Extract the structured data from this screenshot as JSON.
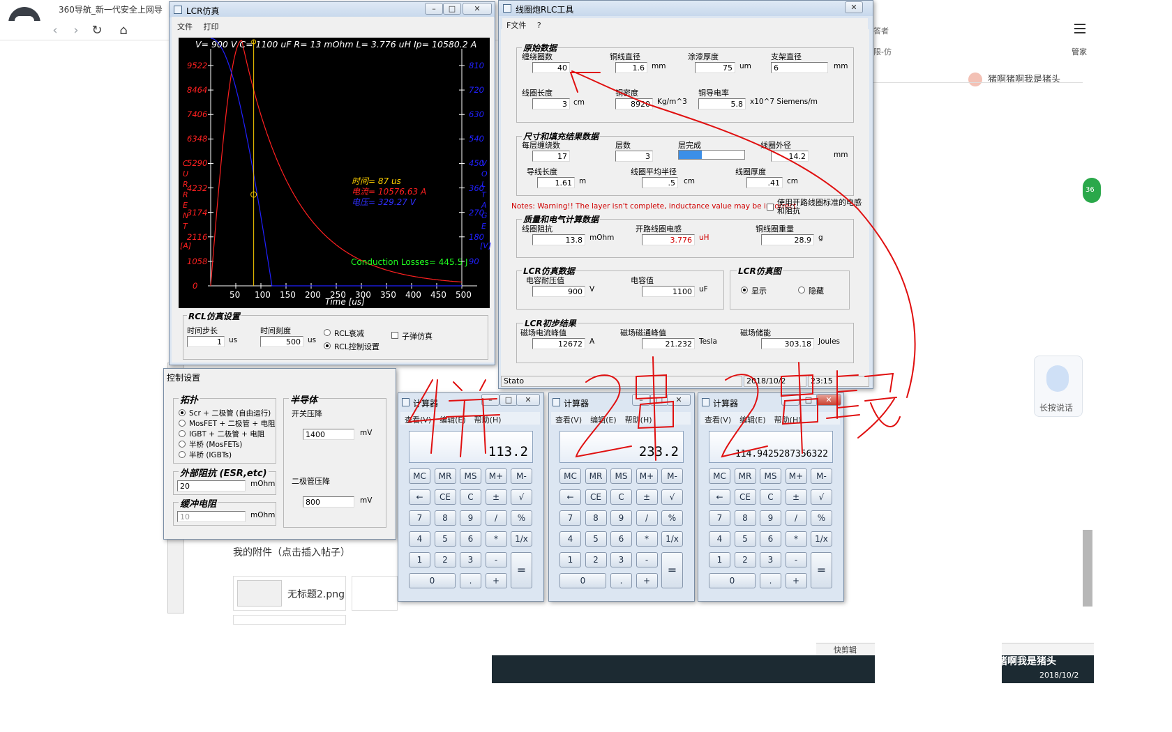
{
  "browser": {
    "tab_title": "360导航_新一代安全上网导",
    "user_name": "猪啊猪啊我是猪头",
    "manage_label": "管家",
    "voice_label": "长按说话",
    "badge_text": "36",
    "quick_edit": "快剪辑",
    "clock_text": "猪啊我是猪头",
    "clock_date": "2018/10/2",
    "right_snips": [
      "答者",
      "限-仿"
    ]
  },
  "attachments": {
    "title": "我的附件（点击插入帖子）",
    "items": [
      {
        "name": "无标题2.png"
      }
    ]
  },
  "lcr_window": {
    "title": "LCR仿真",
    "menu": [
      "文件",
      "打印"
    ],
    "plot": {
      "header": "V= 900 V    C= 1100 uF    R= 13 mOhm    L= 3.776 uH    Ip= 10580.2 A",
      "y_left_ticks": [
        "9522",
        "8464",
        "7406",
        "6348",
        "5290",
        "4232",
        "3174",
        "2116",
        "1058",
        "0"
      ],
      "y_right_ticks": [
        "810",
        "720",
        "630",
        "540",
        "450",
        "360",
        "270",
        "180",
        "90"
      ],
      "x_ticks": [
        "50",
        "100",
        "150",
        "200",
        "250",
        "300",
        "350",
        "400",
        "450",
        "500"
      ],
      "x_axis_title": "Time [us]",
      "y_left_title_letters": [
        "C",
        "U",
        "R",
        "R",
        "E",
        "N",
        "T"
      ],
      "y_left_unit": "[A]",
      "y_right_title_letters": [
        "V",
        "O",
        "L",
        "T",
        "A",
        "G",
        "E"
      ],
      "y_right_unit": "[V]",
      "annotation_time": "时间= 87 us",
      "annotation_current": "电流= 10576.63 A",
      "annotation_voltage": "电压= 329.27 V",
      "conduction_losses": "Conduction Losses= 445.5 J",
      "current_color": "#ff2020",
      "voltage_color": "#2020ff",
      "cursor_color": "#ffd000"
    },
    "settings": {
      "group_title": "RCL仿真设置",
      "time_step_label": "时间步长",
      "time_step_value": "1",
      "time_step_unit": "us",
      "time_scale_label": "时间刻度",
      "time_scale_value": "500",
      "time_scale_unit": "us",
      "radio_decay": "RCL衰减",
      "radio_control": "RCL控制设置",
      "checkbox_bullet": "子弹仿真"
    }
  },
  "rlc_window": {
    "title": "线圈炮RLC工具",
    "menu": [
      "F文件",
      "?"
    ],
    "raw_data": {
      "title": "原始数据",
      "turns_label": "缠绕圈数",
      "turns_value": "40",
      "wire_dia_label": "铜线直径",
      "wire_dia_value": "1.6",
      "wire_dia_unit": "mm",
      "paint_label": "涂漆厚度",
      "paint_value": "75",
      "paint_unit": "um",
      "frame_label": "支架直径",
      "frame_value": "6",
      "frame_unit": "mm",
      "length_label": "线圈长度",
      "length_value": "3",
      "length_unit": "cm",
      "density_label": "铜密度",
      "density_value": "8920",
      "density_unit": "Kg/m^3",
      "conductivity_label": "铜导电率",
      "conductivity_value": "5.8",
      "conductivity_unit": "x10^7 Siemens/m"
    },
    "size_data": {
      "title": "尺寸和填充结果数据",
      "per_layer_label": "每层缠绕数",
      "per_layer_value": "17",
      "layers_label": "层数",
      "layers_value": "3",
      "layer_done_label": "层完成",
      "outer_dia_label": "线圈外径",
      "outer_dia_value": "14.2",
      "outer_dia_unit": "mm",
      "wire_len_label": "导线长度",
      "wire_len_value": "1.61",
      "wire_len_unit": "m",
      "avg_radius_label": "线圈平均半径",
      "avg_radius_value": ".5",
      "avg_radius_unit": "cm",
      "thickness_label": "线圈厚度",
      "thickness_value": ".41",
      "thickness_unit": "cm",
      "layer_progress": 0.35
    },
    "warning": "Notes: Warning!! The layer isn't complete, inductance value may be incorrect",
    "open_circuit_checkbox": "使用开路线圈标准的电感和阻抗",
    "electrical": {
      "title": "质量和电气计算数据",
      "resistance_label": "线圈阻抗",
      "resistance_value": "13.8",
      "resistance_unit": "mOhm",
      "inductance_label": "开路线圈电感",
      "inductance_value": "3.776",
      "inductance_unit": "uH",
      "weight_label": "铜线圈重量",
      "weight_value": "28.9",
      "weight_unit": "g"
    },
    "lcr_sim": {
      "title": "LCR仿真数据",
      "cap_voltage_label": "电容耐压值",
      "cap_voltage_value": "900",
      "cap_voltage_unit": "V",
      "capacitance_label": "电容值",
      "capacitance_value": "1100",
      "capacitance_unit": "uF"
    },
    "lcr_plot": {
      "title": "LCR仿真图",
      "show": "显示",
      "hide": "隐藏"
    },
    "lcr_results": {
      "title": "LCR初步结果",
      "peak_current_label": "磁场电流峰值",
      "peak_current_value": "12672",
      "peak_current_unit": "A",
      "peak_flux_label": "磁场磁通峰值",
      "peak_flux_value": "21.232",
      "peak_flux_unit": "Tesla",
      "energy_label": "磁场储能",
      "energy_value": "303.18",
      "energy_unit": "Joules"
    },
    "status": [
      "Stato",
      "2018/10/2",
      "23:15"
    ]
  },
  "control_window": {
    "title": "控制设置",
    "topology_title": "拓扑",
    "topology_options": [
      "Scr + 二极管 (自由运行)",
      "MosFET + 二极管 + 电阻",
      "IGBT + 二极管 + 电阻",
      "半桥 (MosFETs)",
      "半桥 (IGBTs)"
    ],
    "semi_title": "半导体",
    "switch_drop_label": "开关压降",
    "switch_drop_value": "1400",
    "switch_drop_unit": "mV",
    "diode_drop_label": "二极管压降",
    "diode_drop_value": "800",
    "diode_drop_unit": "mV",
    "esr_title": "外部阻抗 (ESR,etc)",
    "esr_value": "20",
    "esr_unit": "mOhm",
    "snubber_title": "缓冲电阻",
    "snubber_value": "10",
    "snubber_unit": "mOhm"
  },
  "calculators": [
    {
      "title": "计算器",
      "display": "113.2"
    },
    {
      "title": "计算器",
      "display": "233.2"
    },
    {
      "title": "计算器",
      "display": "114.9425287356322"
    }
  ],
  "calculator_menu": [
    "查看(V)",
    "编辑(E)",
    "帮助(H)"
  ],
  "calculator_keys": {
    "row1": [
      "MC",
      "MR",
      "MS",
      "M+",
      "M-"
    ],
    "row2": [
      "←",
      "CE",
      "C",
      "±",
      "√"
    ],
    "row3": [
      "7",
      "8",
      "9",
      "/",
      "%"
    ],
    "row4": [
      "4",
      "5",
      "6",
      "*",
      "1/x"
    ],
    "row5": [
      "1",
      "2",
      "3",
      "-"
    ],
    "row6": [
      "0",
      ".",
      "+"
    ],
    "equals": "="
  },
  "handwriting": {
    "text": "4并2串2串段",
    "color": "#e01010"
  }
}
